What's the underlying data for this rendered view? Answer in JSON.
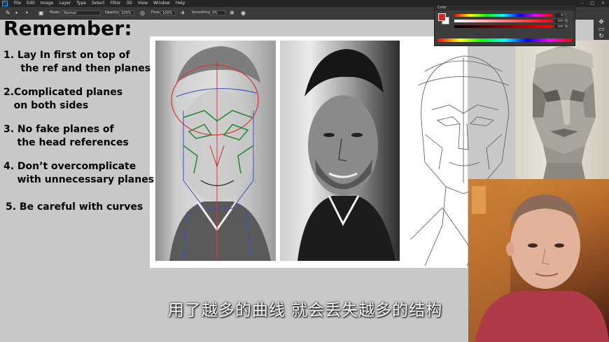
{
  "menubar": {
    "items": [
      "File",
      "Edit",
      "Image",
      "Layer",
      "Type",
      "Select",
      "Filter",
      "3D",
      "View",
      "Window",
      "Help"
    ],
    "app_icon": "Ps"
  },
  "options": {
    "mode_label": "Mode:",
    "mode_value": "Normal",
    "opacity_label": "Opacity:",
    "opacity_value": "100%",
    "flow_label": "Flow:",
    "flow_value": "100%",
    "smoothing_label": "Smoothing:",
    "smoothing_value": "0%"
  },
  "color_panel": {
    "title": "Color",
    "values": [
      "0",
      "100",
      "100"
    ],
    "units": [
      "°",
      "%",
      "%"
    ]
  },
  "lesson": {
    "heading": "Remember:",
    "rules": [
      "1. Lay In first on top of\n     the ref and then planes",
      "2.Complicated planes\n   on both sides",
      "3. No fake planes of\n    the head references",
      "4. Don’t overcomplicate\n    with unnecessary planes",
      "5. Be careful with curves"
    ]
  },
  "subtitle": "用了越多的曲线 就会丢失越多的结构",
  "colors": {
    "menubar_bg": "#252525",
    "options_bg": "#3a3a3a",
    "workspace_bg": "#c9c8c8",
    "accent_red": "#e0201b",
    "ps_blue": "#31a8ff"
  },
  "icons": [
    "brush-icon",
    "brush-settings-icon",
    "pressure-opacity-icon",
    "airbrush-icon",
    "gear-icon",
    "pressure-size-icon",
    "minimize-icon",
    "maximize-icon",
    "close-icon",
    "move-icon"
  ]
}
